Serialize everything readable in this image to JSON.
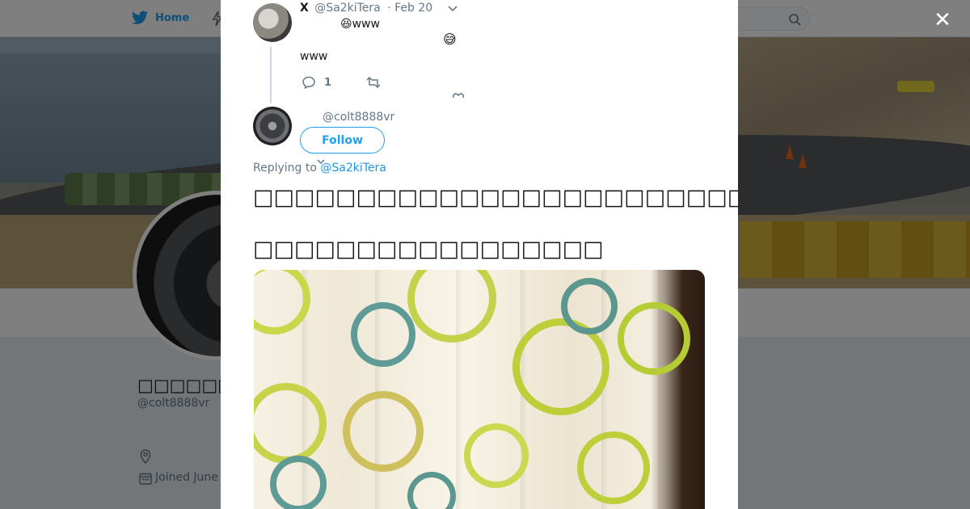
{
  "background": {
    "nav": {
      "home_label": "Home"
    },
    "profile": {
      "display_name": "□□□□□□",
      "screen_name": "@colt8888vr",
      "joined": "Joined June"
    }
  },
  "modal": {
    "parent_tweet": {
      "name": "X",
      "screen_name": "@Sa2kiTera",
      "date": "· Feb 20",
      "text_line1": "😆www",
      "emoji": "😅",
      "text_line2": "www",
      "reply_count": "1"
    },
    "reply_tweet": {
      "screen_name": "@colt8888vr",
      "follow_label": "Follow",
      "replying_prefix": "Replying to",
      "replying_to": "@Sa2kiTera",
      "text_line1": "□□□□□□□□□□□□□□□□□□□□□□□□□□□□□□□□□□□□□□□□□□□",
      "text_line2": "□□□□□□□□□□□□□□□□□"
    }
  },
  "close_label": "✕",
  "colors": {
    "accent": "#1da1f2",
    "link": "#1b95e0",
    "secondary_text": "#657786",
    "overlay": "rgba(0,0,0,0.5)"
  },
  "icons": [
    "twitter-bird-icon",
    "lightning-icon",
    "search-icon",
    "chevron-down-icon",
    "reply-icon",
    "retweet-icon",
    "like-icon",
    "location-icon",
    "calendar-icon",
    "close-icon"
  ]
}
